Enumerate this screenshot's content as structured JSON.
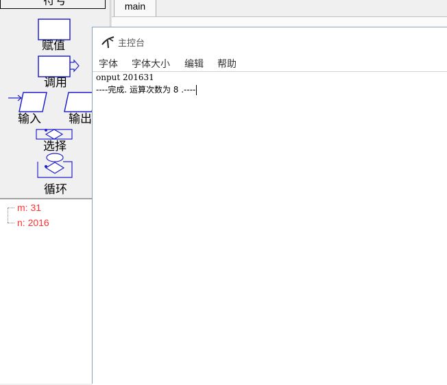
{
  "palette": {
    "top_label": "符号",
    "blocks": [
      {
        "label": "赋值",
        "icon": "assign-block-icon"
      },
      {
        "label": "调用",
        "icon": "call-block-icon"
      },
      {
        "label": "输入",
        "icon": "input-block-icon"
      },
      {
        "label": "输出",
        "icon": "output-block-icon"
      },
      {
        "label": "选择",
        "icon": "selection-block-icon"
      },
      {
        "label": "循环",
        "icon": "loop-block-icon"
      }
    ]
  },
  "variables": [
    {
      "label": "m: 31"
    },
    {
      "label": "n: 2016"
    }
  ],
  "tabs": [
    {
      "label": "main"
    }
  ],
  "console": {
    "title": "主控台",
    "menu": [
      "字体",
      "字体大小",
      "编辑",
      "帮助"
    ],
    "lines": [
      "onput 201631",
      "----完成. 运算次数为  8 .----"
    ]
  },
  "colors": {
    "block_stroke": "#2020cc",
    "variable_text": "#ff3030"
  }
}
